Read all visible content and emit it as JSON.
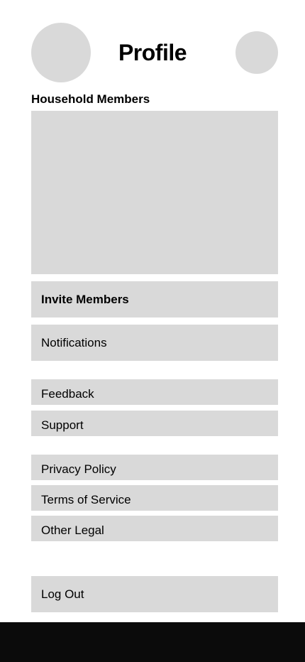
{
  "header": {
    "title": "Profile"
  },
  "household": {
    "heading": "Household Members"
  },
  "menu": {
    "invite": "Invite Members",
    "notifications": "Notifications",
    "feedback": "Feedback",
    "support": "Support",
    "privacy": "Privacy Policy",
    "terms": "Terms of Service",
    "other_legal": "Other Legal",
    "logout": "Log Out"
  }
}
